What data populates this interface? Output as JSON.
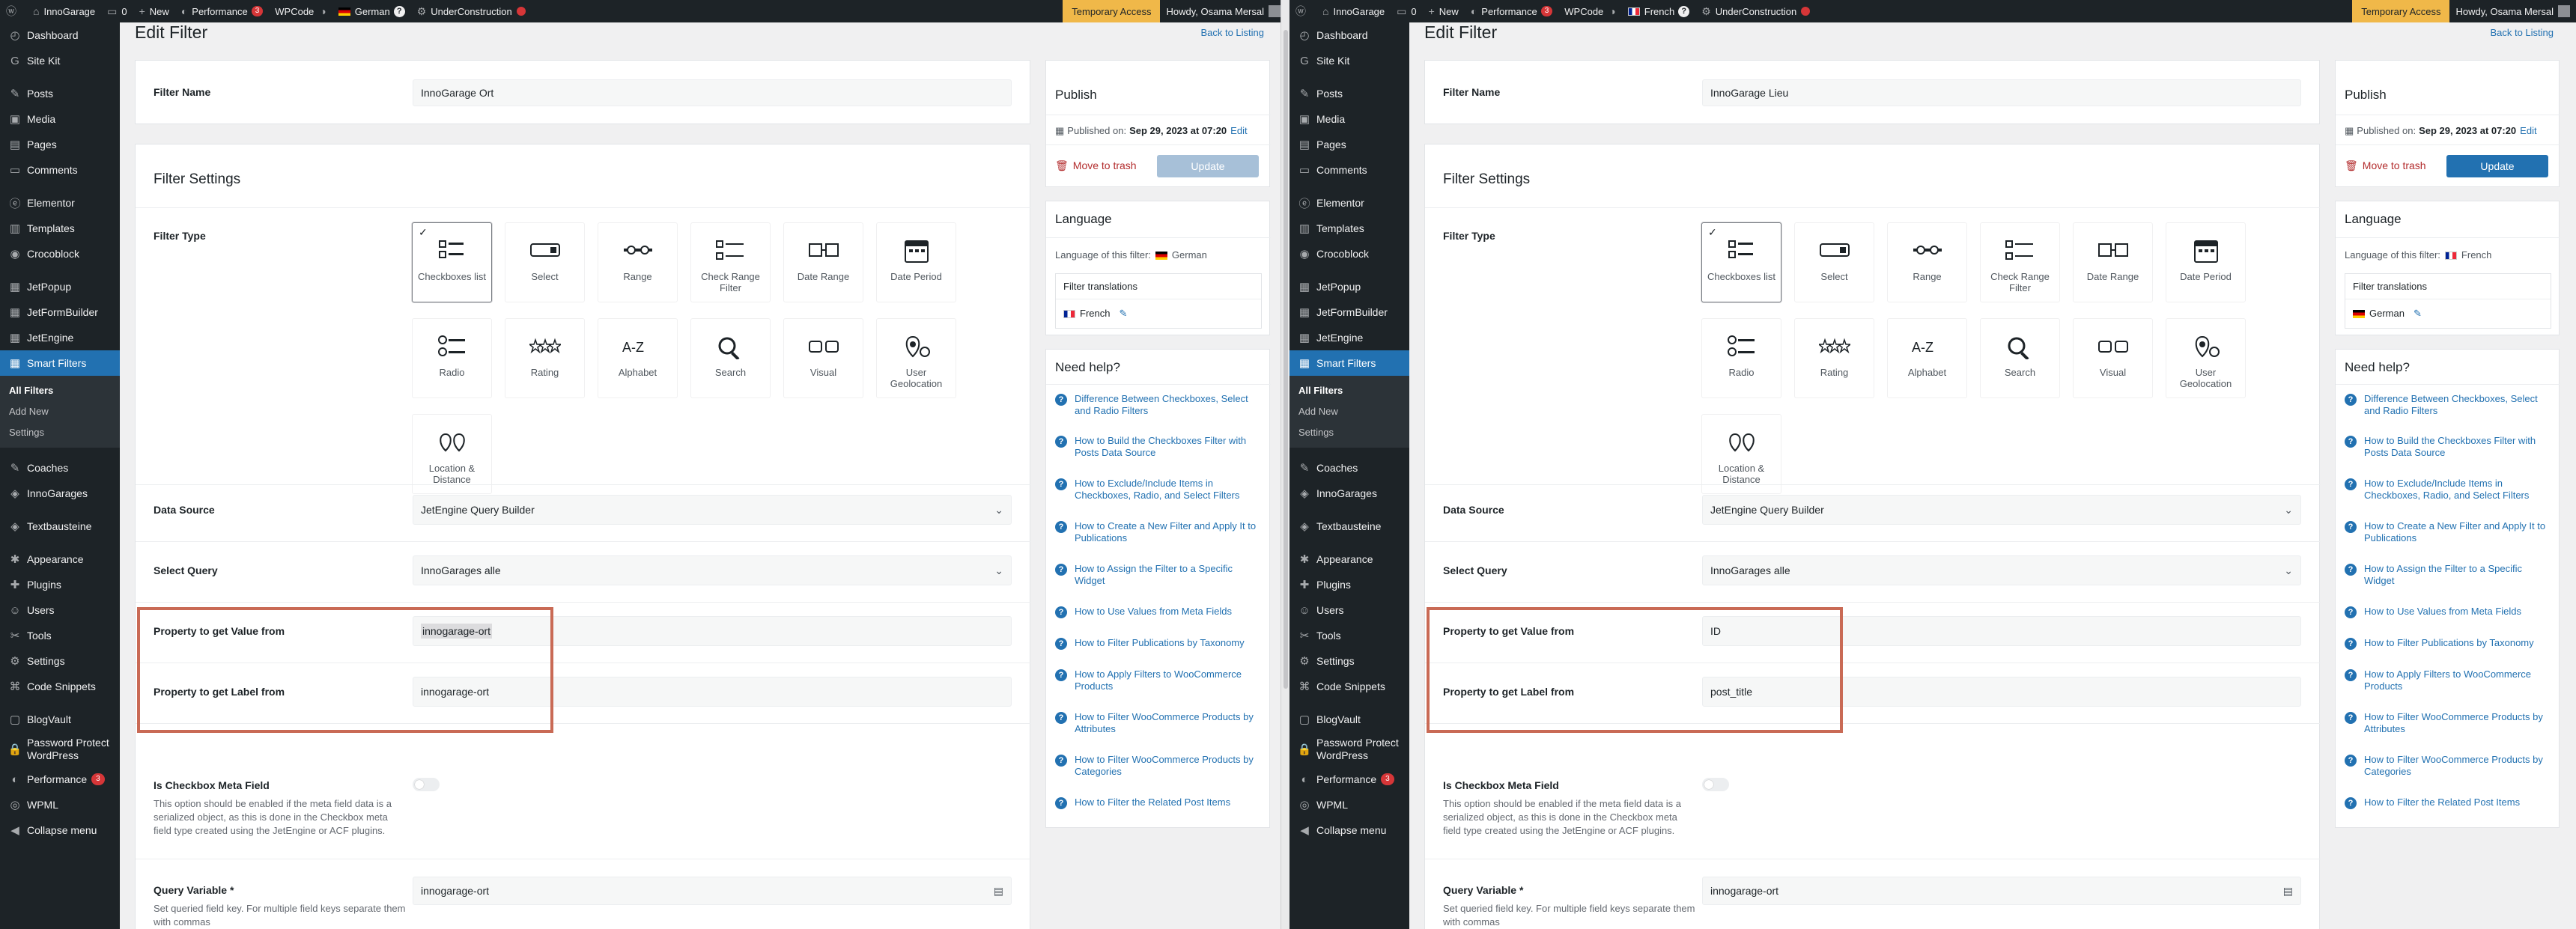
{
  "panes": [
    {
      "id": "left",
      "admin_bar": {
        "site_name": "InnoGarage",
        "comments_count": "0",
        "new_label": "New",
        "performance_label": "Performance",
        "performance_badge": "3",
        "wpcode_label": "WPCode",
        "language_label": "German",
        "underconstruction_label": "UnderConstruction",
        "temp_access_label": "Temporary Access",
        "howdy": "Howdy, Osama Mersal"
      },
      "sidebar": {
        "items_top": [
          "Dashboard",
          "Site Kit",
          "Posts",
          "Media",
          "Pages",
          "Comments",
          "Elementor",
          "Templates",
          "Crocoblock",
          "JetPopup",
          "JetFormBuilder",
          "JetEngine",
          "Smart Filters"
        ],
        "submenu": [
          "All Filters",
          "Add New",
          "Settings"
        ],
        "items_bottom": [
          "Coaches",
          "InnoGarages",
          "Textbausteine",
          "Appearance",
          "Plugins",
          "Users",
          "Tools",
          "Settings",
          "Code Snippets",
          "BlogVault",
          "Password Protect WordPress",
          "Performance",
          "WPML",
          "Collapse menu"
        ],
        "performance_badge": "3"
      },
      "page_title": "Edit Filter",
      "back_link": "Back to Listing",
      "filter_name_label": "Filter Name",
      "filter_name_value": "InnoGarage Ort",
      "filter_settings_title": "Filter Settings",
      "filter_type_label": "Filter Type",
      "filter_types": [
        "Checkboxes list",
        "Select",
        "Range",
        "Check Range Filter",
        "Date Range",
        "Date Period",
        "Radio",
        "Rating",
        "Alphabet",
        "Search",
        "Visual",
        "User Geolocation",
        "Location & Distance"
      ],
      "data_source_label": "Data Source",
      "data_source_value": "JetEngine Query Builder",
      "select_query_label": "Select Query",
      "select_query_value": "InnoGarages alle",
      "prop_value_label": "Property to get Value from",
      "prop_value_value": "innogarage-ort",
      "prop_label_label": "Property to get Label from",
      "prop_label_value": "innogarage-ort",
      "checkbox_meta_label": "Is Checkbox Meta Field",
      "checkbox_meta_help": "This option should be enabled if the meta field data is a serialized object, as this is done in the Checkbox meta field type created using the JetEngine or ACF plugins.",
      "query_var_label": "Query Variable *",
      "query_var_value": "innogarage-ort",
      "query_var_help": "Set queried field key. For multiple field keys separate them with commas",
      "publish": {
        "title": "Publish",
        "published_on": "Published on:",
        "date": "Sep 29, 2023 at 07:20",
        "edit": "Edit",
        "trash": "Move to trash",
        "update": "Update"
      },
      "language": {
        "title": "Language",
        "of_filter": "Language of this filter:",
        "current": "German",
        "translations_label": "Filter translations",
        "translation": "French"
      },
      "help": {
        "title": "Need help?",
        "links": [
          "Difference Between Checkboxes, Select and Radio Filters",
          "How to Build the Checkboxes Filter with Posts Data Source",
          "How to Exclude/Include Items in Checkboxes, Radio, and Select Filters",
          "How to Create a New Filter and Apply It to Publications",
          "How to Assign the Filter to a Specific Widget",
          "How to Use Values from Meta Fields",
          "How to Filter Publications by Taxonomy",
          "How to Apply Filters to WooCommerce Products",
          "How to Filter WooCommerce Products by Attributes",
          "How to Filter WooCommerce Products by Categories",
          "How to Filter the Related Post Items"
        ]
      }
    },
    {
      "id": "right",
      "admin_bar": {
        "site_name": "InnoGarage",
        "comments_count": "0",
        "new_label": "New",
        "performance_label": "Performance",
        "performance_badge": "3",
        "wpcode_label": "WPCode",
        "language_label": "French",
        "underconstruction_label": "UnderConstruction",
        "temp_access_label": "Temporary Access",
        "howdy": "Howdy, Osama Mersal"
      },
      "sidebar": {
        "items_top": [
          "Dashboard",
          "Site Kit",
          "Posts",
          "Media",
          "Pages",
          "Comments",
          "Elementor",
          "Templates",
          "Crocoblock",
          "JetPopup",
          "JetFormBuilder",
          "JetEngine",
          "Smart Filters"
        ],
        "submenu": [
          "All Filters",
          "Add New",
          "Settings"
        ],
        "items_bottom": [
          "Coaches",
          "InnoGarages",
          "Textbausteine",
          "Appearance",
          "Plugins",
          "Users",
          "Tools",
          "Settings",
          "Code Snippets",
          "BlogVault",
          "Password Protect WordPress",
          "Performance",
          "WPML",
          "Collapse menu"
        ],
        "performance_badge": "3"
      },
      "page_title": "Edit Filter",
      "back_link": "Back to Listing",
      "filter_name_label": "Filter Name",
      "filter_name_value": "InnoGarage Lieu",
      "filter_settings_title": "Filter Settings",
      "filter_type_label": "Filter Type",
      "filter_types": [
        "Checkboxes list",
        "Select",
        "Range",
        "Check Range Filter",
        "Date Range",
        "Date Period",
        "Radio",
        "Rating",
        "Alphabet",
        "Search",
        "Visual",
        "User Geolocation",
        "Location & Distance"
      ],
      "data_source_label": "Data Source",
      "data_source_value": "JetEngine Query Builder",
      "select_query_label": "Select Query",
      "select_query_value": "InnoGarages alle",
      "prop_value_label": "Property to get Value from",
      "prop_value_value": "ID",
      "prop_label_label": "Property to get Label from",
      "prop_label_value": "post_title",
      "checkbox_meta_label": "Is Checkbox Meta Field",
      "checkbox_meta_help": "This option should be enabled if the meta field data is a serialized object, as this is done in the Checkbox meta field type created using the JetEngine or ACF plugins.",
      "query_var_label": "Query Variable *",
      "query_var_value": "innogarage-ort",
      "query_var_help": "Set queried field key. For multiple field keys separate them with commas",
      "publish": {
        "title": "Publish",
        "published_on": "Published on:",
        "date": "Sep 29, 2023 at 07:20",
        "edit": "Edit",
        "trash": "Move to trash",
        "update": "Update"
      },
      "language": {
        "title": "Language",
        "of_filter": "Language of this filter:",
        "current": "French",
        "translations_label": "Filter translations",
        "translation": "German"
      },
      "help": {
        "title": "Need help?",
        "links": [
          "Difference Between Checkboxes, Select and Radio Filters",
          "How to Build the Checkboxes Filter with Posts Data Source",
          "How to Exclude/Include Items in Checkboxes, Radio, and Select Filters",
          "How to Create a New Filter and Apply It to Publications",
          "How to Assign the Filter to a Specific Widget",
          "How to Use Values from Meta Fields",
          "How to Filter Publications by Taxonomy",
          "How to Apply Filters to WooCommerce Products",
          "How to Filter WooCommerce Products by Attributes",
          "How to Filter WooCommerce Products by Categories",
          "How to Filter the Related Post Items"
        ]
      }
    }
  ]
}
